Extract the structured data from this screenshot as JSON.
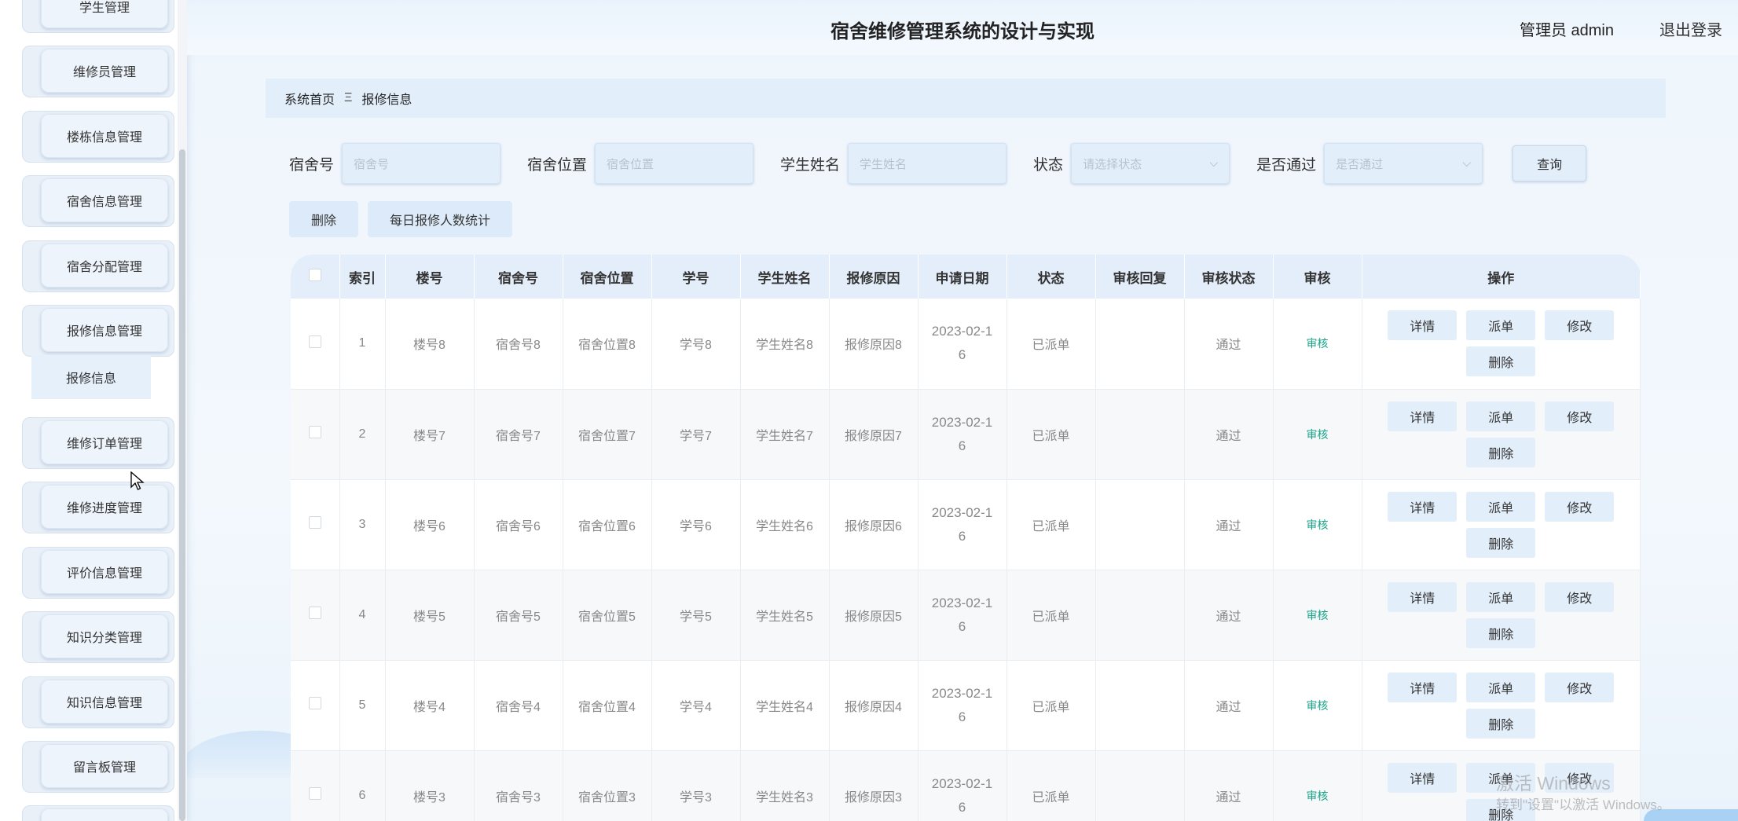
{
  "header": {
    "title": "宿舍维修管理系统的设计与实现",
    "user": "管理员 admin",
    "logout": "退出登录"
  },
  "sidebar": {
    "items": [
      {
        "label": "学生管理"
      },
      {
        "label": "维修员管理"
      },
      {
        "label": "楼栋信息管理"
      },
      {
        "label": "宿舍信息管理"
      },
      {
        "label": "宿舍分配管理"
      },
      {
        "label": "报修信息管理"
      },
      {
        "label": "维修订单管理"
      },
      {
        "label": "维修进度管理"
      },
      {
        "label": "评价信息管理"
      },
      {
        "label": "知识分类管理"
      },
      {
        "label": "知识信息管理"
      },
      {
        "label": "留言板管理"
      }
    ],
    "submenu": "报修信息"
  },
  "breadcrumb": {
    "home": "系统首页",
    "sep": "Ξ",
    "current": "报修信息"
  },
  "search": {
    "dorm_no": {
      "label": "宿舍号",
      "placeholder": "宿舍号"
    },
    "dorm_loc": {
      "label": "宿舍位置",
      "placeholder": "宿舍位置"
    },
    "student_name": {
      "label": "学生姓名",
      "placeholder": "学生姓名"
    },
    "status": {
      "label": "状态",
      "placeholder": "请选择状态"
    },
    "passed": {
      "label": "是否通过",
      "placeholder": "是否通过"
    },
    "query": "查询"
  },
  "actions": {
    "delete": "删除",
    "stats": "每日报修人数统计"
  },
  "table": {
    "headers": [
      "索引",
      "楼号",
      "宿舍号",
      "宿舍位置",
      "学号",
      "学生姓名",
      "报修原因",
      "申请日期",
      "状态",
      "审核回复",
      "审核状态",
      "审核",
      "操作"
    ],
    "rows": [
      {
        "idx": "1",
        "building": "楼号8",
        "dorm": "宿舍号8",
        "loc": "宿舍位置8",
        "sid": "学号8",
        "name": "学生姓名8",
        "reason": "报修原因8",
        "date1": "2023-02-1",
        "date2": "6",
        "status": "已派单",
        "reply": "",
        "audit_status": "通过",
        "audit": "审核"
      },
      {
        "idx": "2",
        "building": "楼号7",
        "dorm": "宿舍号7",
        "loc": "宿舍位置7",
        "sid": "学号7",
        "name": "学生姓名7",
        "reason": "报修原因7",
        "date1": "2023-02-1",
        "date2": "6",
        "status": "已派单",
        "reply": "",
        "audit_status": "通过",
        "audit": "审核"
      },
      {
        "idx": "3",
        "building": "楼号6",
        "dorm": "宿舍号6",
        "loc": "宿舍位置6",
        "sid": "学号6",
        "name": "学生姓名6",
        "reason": "报修原因6",
        "date1": "2023-02-1",
        "date2": "6",
        "status": "已派单",
        "reply": "",
        "audit_status": "通过",
        "audit": "审核"
      },
      {
        "idx": "4",
        "building": "楼号5",
        "dorm": "宿舍号5",
        "loc": "宿舍位置5",
        "sid": "学号5",
        "name": "学生姓名5",
        "reason": "报修原因5",
        "date1": "2023-02-1",
        "date2": "6",
        "status": "已派单",
        "reply": "",
        "audit_status": "通过",
        "audit": "审核"
      },
      {
        "idx": "5",
        "building": "楼号4",
        "dorm": "宿舍号4",
        "loc": "宿舍位置4",
        "sid": "学号4",
        "name": "学生姓名4",
        "reason": "报修原因4",
        "date1": "2023-02-1",
        "date2": "6",
        "status": "已派单",
        "reply": "",
        "audit_status": "通过",
        "audit": "审核"
      },
      {
        "idx": "6",
        "building": "楼号3",
        "dorm": "宿舍号3",
        "loc": "宿舍位置3",
        "sid": "学号3",
        "name": "学生姓名3",
        "reason": "报修原因3",
        "date1": "2023-02-1",
        "date2": "6",
        "status": "已派单",
        "reply": "",
        "audit_status": "通过",
        "audit": "审核"
      }
    ],
    "ops": {
      "detail": "详情",
      "dispatch": "派单",
      "edit": "修改",
      "delete": "删除"
    }
  },
  "watermark": {
    "line1": "激活 Windows",
    "line2": "转到\"设置\"以激活 Windows。"
  }
}
